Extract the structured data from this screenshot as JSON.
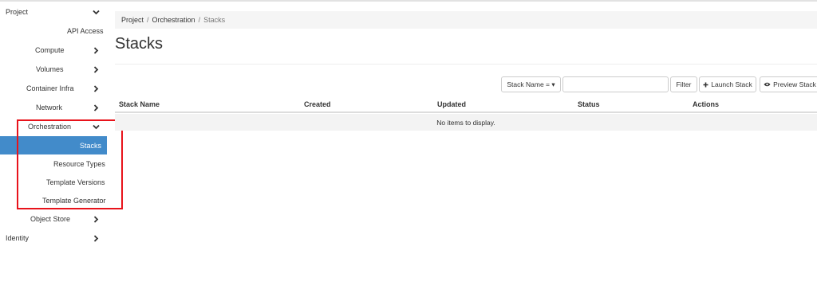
{
  "sidebar": {
    "project": "Project",
    "api_access": "API Access",
    "items": [
      {
        "label": "Compute",
        "chevron": "chevron-right-icon"
      },
      {
        "label": "Volumes",
        "chevron": "chevron-right-icon"
      },
      {
        "label": "Container Infra",
        "chevron": "chevron-right-icon"
      },
      {
        "label": "Network",
        "chevron": "chevron-right-icon"
      }
    ],
    "orchestration": {
      "label": "Orchestration",
      "chevron": "chevron-down-icon",
      "children": [
        "Stacks",
        "Resource Types",
        "Template Versions",
        "Template Generator"
      ],
      "active_child": "Stacks"
    },
    "object_store": "Object Store",
    "identity": "Identity",
    "active_color": "#428bca",
    "highlight_color": "#e8131b"
  },
  "breadcrumb": {
    "items": [
      "Project",
      "Orchestration"
    ],
    "separator": "/",
    "current": "Stacks"
  },
  "page": {
    "title": "Stacks"
  },
  "toolbar": {
    "filter_select": "Stack Name = ▾",
    "search_value": "",
    "filter_button": "Filter",
    "launch_button": "Launch Stack",
    "preview_button": "Preview Stack"
  },
  "table": {
    "columns": [
      "Stack Name",
      "Created",
      "Updated",
      "Status",
      "Actions"
    ],
    "empty_message": "No items to display."
  }
}
